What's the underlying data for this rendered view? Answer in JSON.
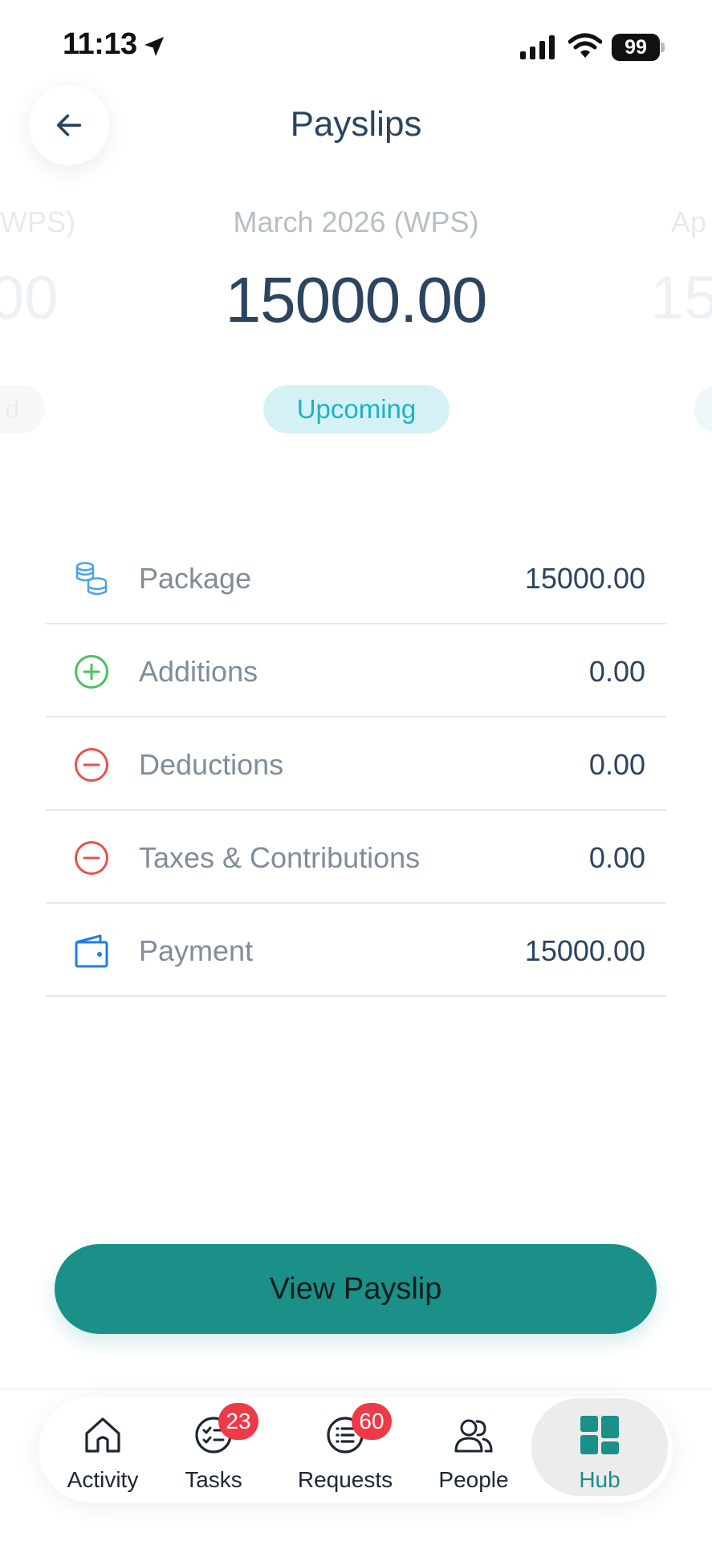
{
  "status_bar": {
    "time": "11:13",
    "battery": "99"
  },
  "header": {
    "title": "Payslips"
  },
  "carousel": {
    "prev": {
      "period": "(WPS)",
      "amount": "00",
      "badge": "d"
    },
    "current": {
      "period": "March 2026 (WPS)",
      "amount": "15000.00",
      "badge": "Upcoming"
    },
    "next": {
      "period": "Ap",
      "amount": "15"
    }
  },
  "breakdown": [
    {
      "label": "Package",
      "value": "15000.00",
      "icon": "coins-icon",
      "color": "#4aa3e6"
    },
    {
      "label": "Additions",
      "value": "0.00",
      "icon": "plus-circle-icon",
      "color": "#4cc15e"
    },
    {
      "label": "Deductions",
      "value": "0.00",
      "icon": "minus-circle-icon",
      "color": "#e5534b"
    },
    {
      "label": "Taxes & Contributions",
      "value": "0.00",
      "icon": "minus-circle-icon",
      "color": "#e5534b"
    },
    {
      "label": "Payment",
      "value": "15000.00",
      "icon": "wallet-icon",
      "color": "#1f7fe0"
    }
  ],
  "cta": {
    "label": "View Payslip"
  },
  "nav": {
    "items": [
      {
        "label": "Activity",
        "icon": "home-icon"
      },
      {
        "label": "Tasks",
        "icon": "checklist-icon",
        "badge": "23"
      },
      {
        "label": "Requests",
        "icon": "list-icon",
        "badge": "60"
      },
      {
        "label": "People",
        "icon": "people-icon"
      },
      {
        "label": "Hub",
        "icon": "grid-icon",
        "active": true
      }
    ]
  },
  "colors": {
    "accent": "#1a9088",
    "badge_red": "#ee3a48",
    "upcoming_bg": "#d4f2f6",
    "upcoming_text": "#1db2c4"
  }
}
